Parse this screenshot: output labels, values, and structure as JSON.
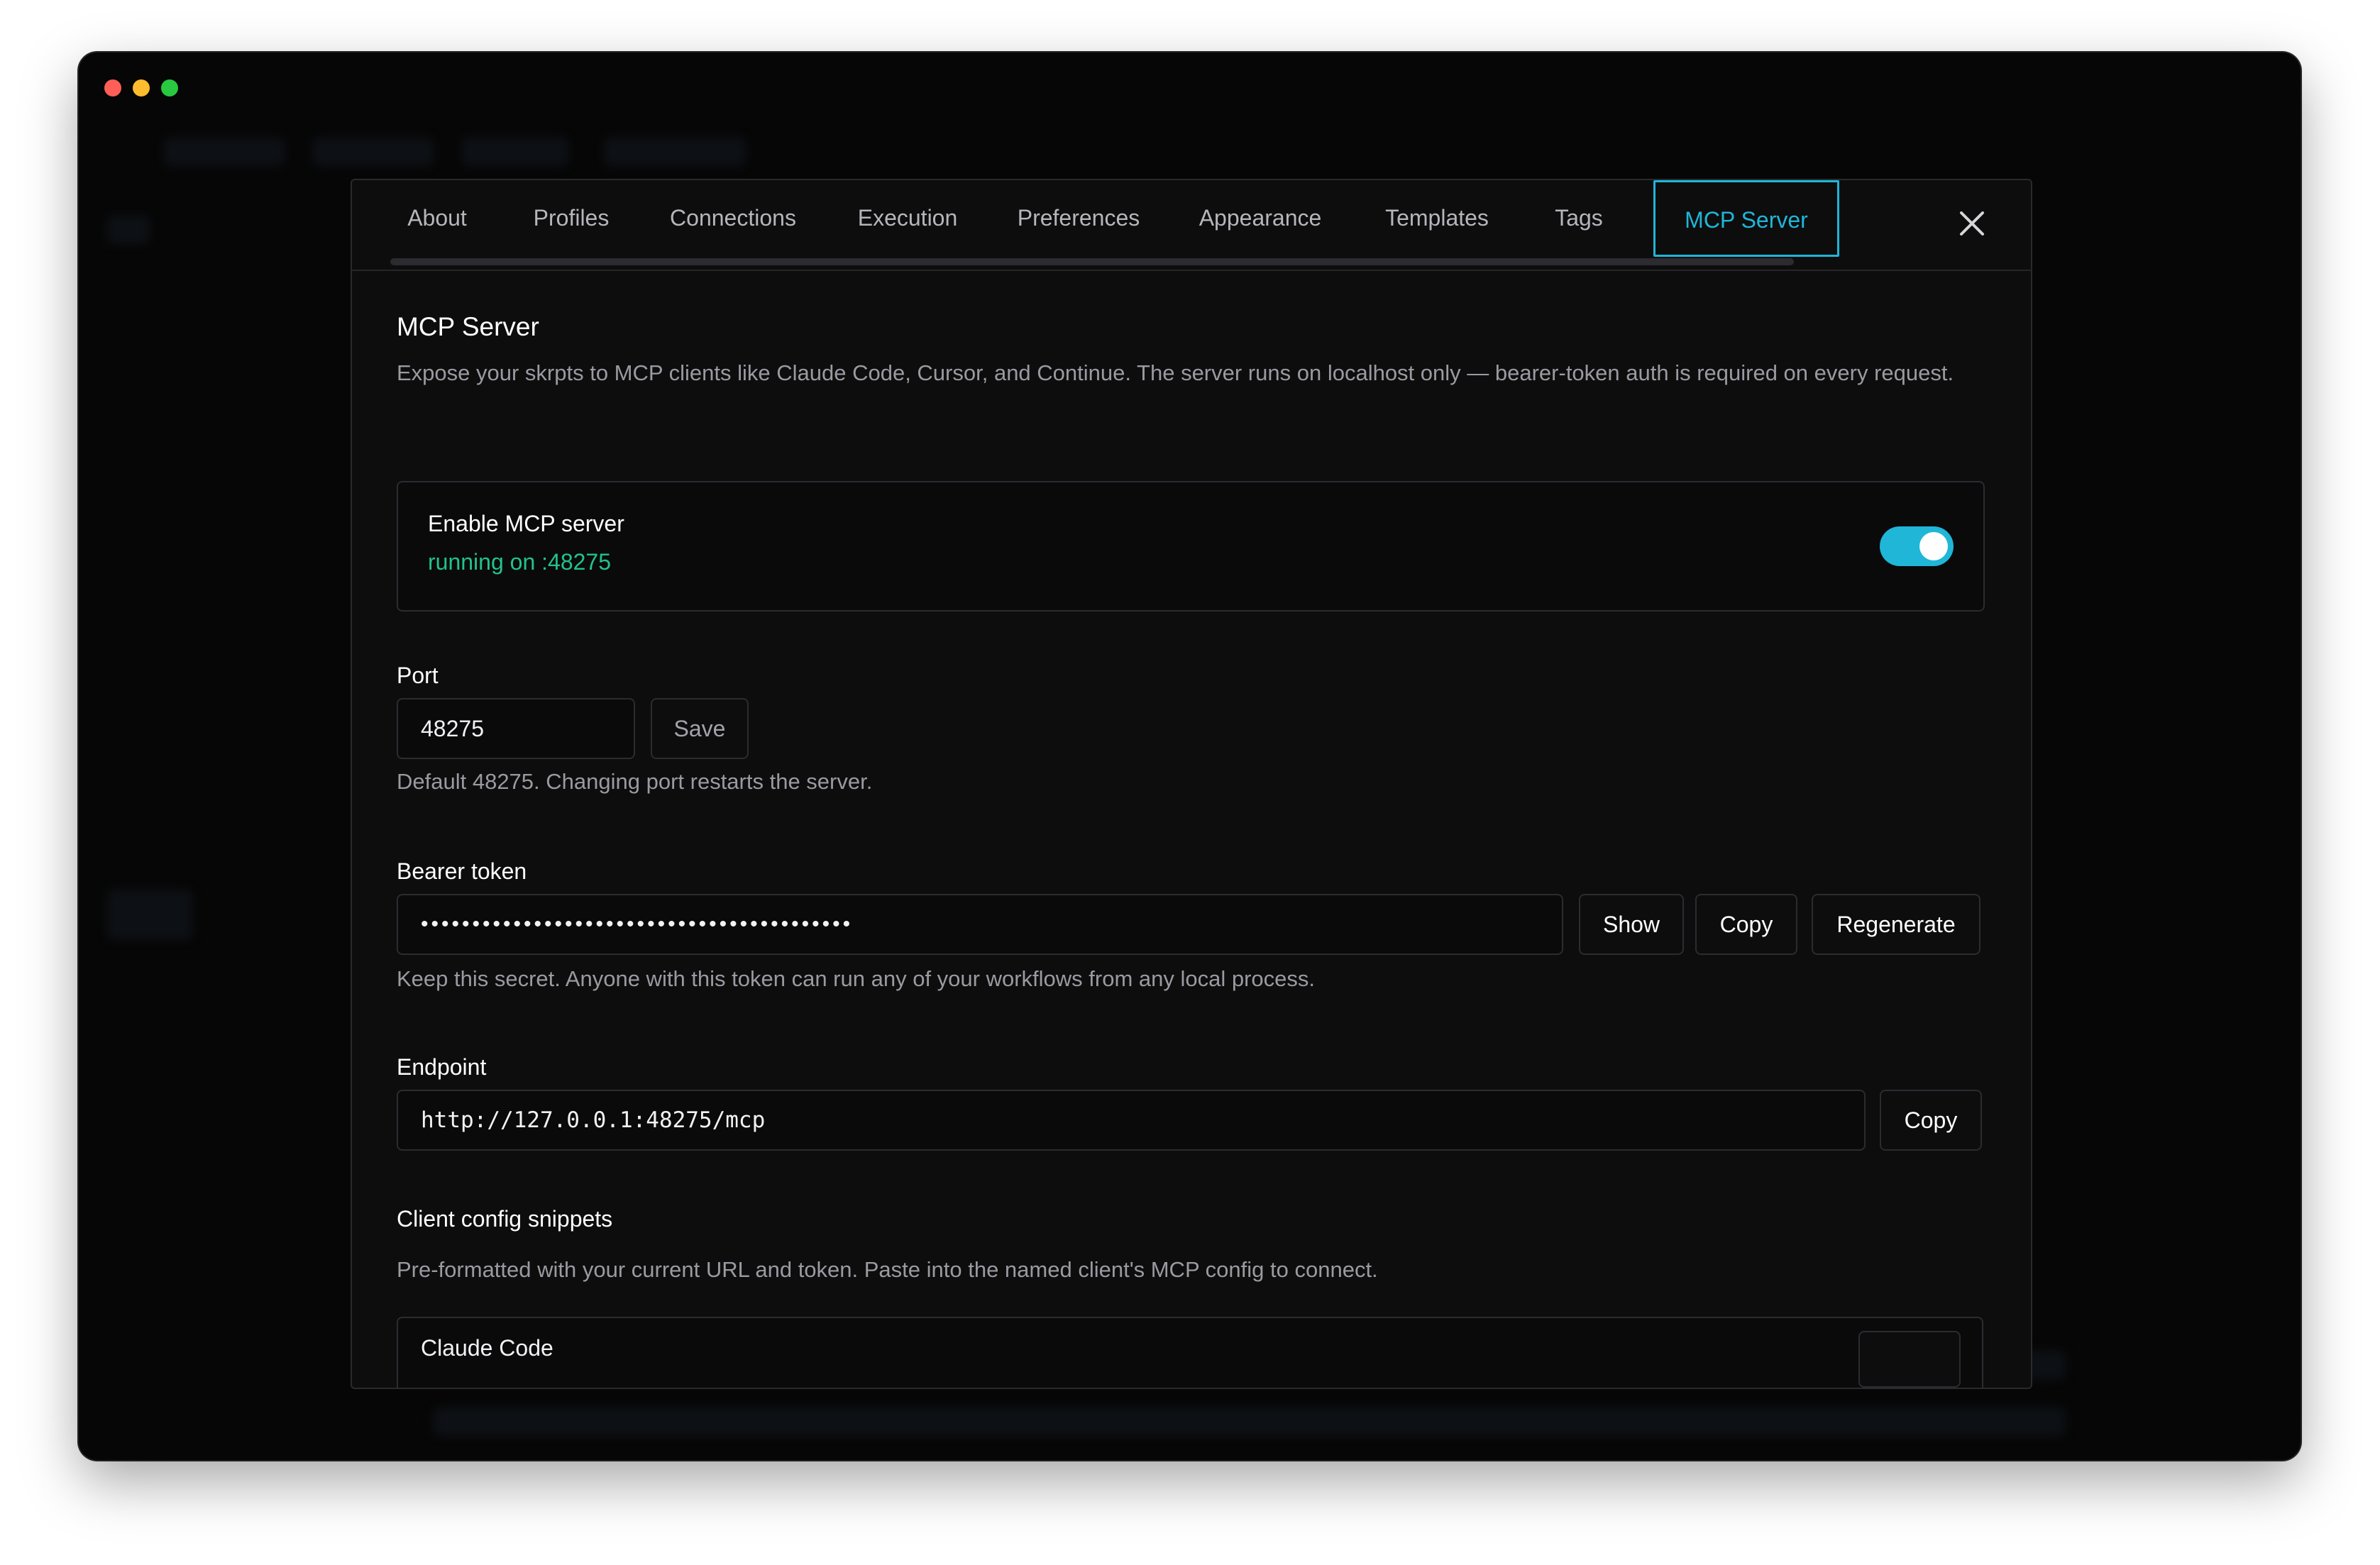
{
  "tabs": [
    {
      "label": "About"
    },
    {
      "label": "Profiles"
    },
    {
      "label": "Connections"
    },
    {
      "label": "Execution"
    },
    {
      "label": "Preferences"
    },
    {
      "label": "Appearance"
    },
    {
      "label": "Templates"
    },
    {
      "label": "Tags"
    },
    {
      "label": "MCP Server",
      "active": true
    }
  ],
  "section": {
    "title": "MCP Server",
    "description": "Expose your skrpts to MCP clients like Claude Code, Cursor, and Continue. The server runs on localhost only — bearer-token auth is required on every request."
  },
  "enable": {
    "label": "Enable MCP server",
    "status": "running on :48275",
    "enabled": true
  },
  "port": {
    "label": "Port",
    "value": "48275",
    "save_label": "Save",
    "hint": "Default 48275. Changing port restarts the server."
  },
  "token": {
    "label": "Bearer token",
    "masked_value": "••••••••••••••••••••••••••••••••••••••••••",
    "show_label": "Show",
    "copy_label": "Copy",
    "regenerate_label": "Regenerate",
    "hint": "Keep this secret. Anyone with this token can run any of your workflows from any local process."
  },
  "endpoint": {
    "label": "Endpoint",
    "value": "http://127.0.0.1:48275/mcp",
    "copy_label": "Copy"
  },
  "snippets": {
    "label": "Client config snippets",
    "hint": "Pre-formatted with your current URL and token. Paste into the named client's MCP config to connect.",
    "first_client": "Claude Code"
  },
  "colors": {
    "accent": "#1fb6d8",
    "status_ok": "#22c38a"
  }
}
